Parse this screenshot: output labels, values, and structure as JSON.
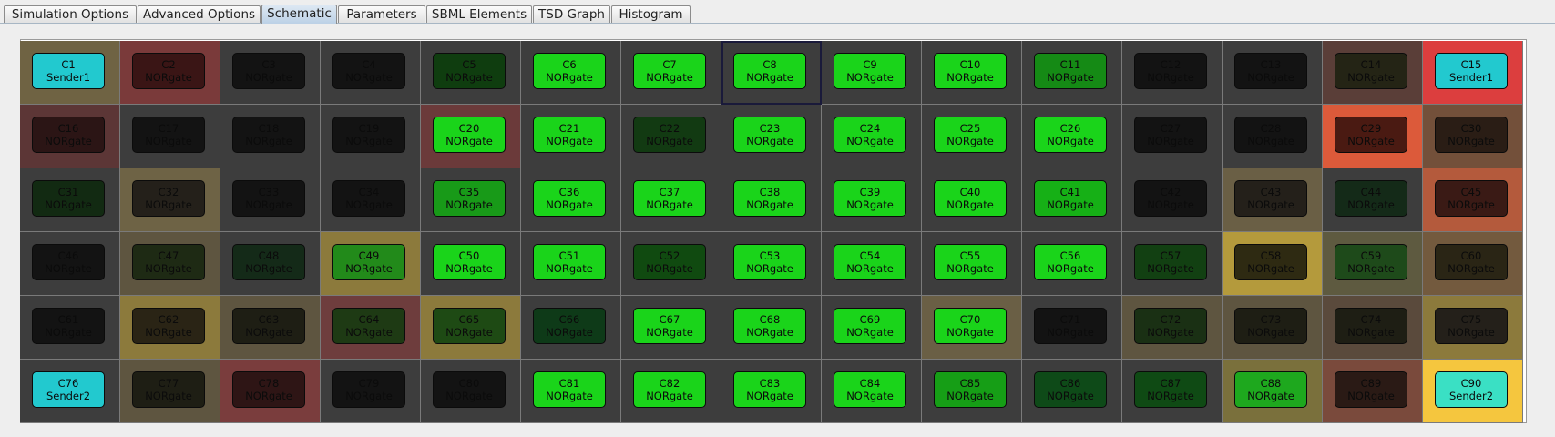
{
  "tabs": [
    {
      "label": "Simulation Options",
      "active": false
    },
    {
      "label": "Advanced Options",
      "active": false
    },
    {
      "label": "Schematic",
      "active": true
    },
    {
      "label": "Parameters",
      "active": false
    },
    {
      "label": "SBML Elements",
      "active": false
    },
    {
      "label": "TSD Graph",
      "active": false
    },
    {
      "label": "Histogram",
      "active": false
    }
  ],
  "selected_cell": "C8",
  "grid": {
    "rows": 6,
    "cols": 15,
    "cells": [
      {
        "id": "C1",
        "type": "Sender1",
        "cell_color": "#6f6343",
        "gate_color": "#22c9cf"
      },
      {
        "id": "C2",
        "type": "NORgate",
        "cell_color": "#7a3a3a",
        "gate_color": "#3a1515"
      },
      {
        "id": "C3",
        "type": "NORgate",
        "cell_color": "#3d3d3d",
        "gate_color": "#131313"
      },
      {
        "id": "C4",
        "type": "NORgate",
        "cell_color": "#3d3d3d",
        "gate_color": "#131313"
      },
      {
        "id": "C5",
        "type": "NORgate",
        "cell_color": "#3d3d3d",
        "gate_color": "#0f3d0f"
      },
      {
        "id": "C6",
        "type": "NORgate",
        "cell_color": "#3d3d3d",
        "gate_color": "#1ad41a"
      },
      {
        "id": "C7",
        "type": "NORgate",
        "cell_color": "#3d3d3d",
        "gate_color": "#1ad41a"
      },
      {
        "id": "C8",
        "type": "NORgate",
        "cell_color": "#3d3d3d",
        "gate_color": "#1ad41a"
      },
      {
        "id": "C9",
        "type": "NORgate",
        "cell_color": "#3d3d3d",
        "gate_color": "#1ad41a"
      },
      {
        "id": "C10",
        "type": "NORgate",
        "cell_color": "#3d3d3d",
        "gate_color": "#1ad41a"
      },
      {
        "id": "C11",
        "type": "NORgate",
        "cell_color": "#3d3d3d",
        "gate_color": "#158a15"
      },
      {
        "id": "C12",
        "type": "NORgate",
        "cell_color": "#3d3d3d",
        "gate_color": "#131313"
      },
      {
        "id": "C13",
        "type": "NORgate",
        "cell_color": "#3d3d3d",
        "gate_color": "#131313"
      },
      {
        "id": "C14",
        "type": "NORgate",
        "cell_color": "#5a3e38",
        "gate_color": "#242415"
      },
      {
        "id": "C15",
        "type": "Sender1",
        "cell_color": "#dc3e3e",
        "gate_color": "#22c9cf"
      },
      {
        "id": "C16",
        "type": "NORgate",
        "cell_color": "#5c3636",
        "gate_color": "#2b1515"
      },
      {
        "id": "C17",
        "type": "NORgate",
        "cell_color": "#3d3d3d",
        "gate_color": "#131313"
      },
      {
        "id": "C18",
        "type": "NORgate",
        "cell_color": "#3d3d3d",
        "gate_color": "#131313"
      },
      {
        "id": "C19",
        "type": "NORgate",
        "cell_color": "#3d3d3d",
        "gate_color": "#131313"
      },
      {
        "id": "C20",
        "type": "NORgate",
        "cell_color": "#6b3a3a",
        "gate_color": "#1ad41a"
      },
      {
        "id": "C21",
        "type": "NORgate",
        "cell_color": "#3d3d3d",
        "gate_color": "#1ad41a"
      },
      {
        "id": "C22",
        "type": "NORgate",
        "cell_color": "#3d3d3d",
        "gate_color": "#123a12"
      },
      {
        "id": "C23",
        "type": "NORgate",
        "cell_color": "#3d3d3d",
        "gate_color": "#1ad41a"
      },
      {
        "id": "C24",
        "type": "NORgate",
        "cell_color": "#3d3d3d",
        "gate_color": "#1ad41a"
      },
      {
        "id": "C25",
        "type": "NORgate",
        "cell_color": "#3d3d3d",
        "gate_color": "#1ad41a"
      },
      {
        "id": "C26",
        "type": "NORgate",
        "cell_color": "#3d3d3d",
        "gate_color": "#1ad41a"
      },
      {
        "id": "C27",
        "type": "NORgate",
        "cell_color": "#3d3d3d",
        "gate_color": "#131313"
      },
      {
        "id": "C28",
        "type": "NORgate",
        "cell_color": "#3d3d3d",
        "gate_color": "#131313"
      },
      {
        "id": "C29",
        "type": "NORgate",
        "cell_color": "#dc5a3a",
        "gate_color": "#4a1a12"
      },
      {
        "id": "C30",
        "type": "NORgate",
        "cell_color": "#73503a",
        "gate_color": "#2a1d15"
      },
      {
        "id": "C31",
        "type": "NORgate",
        "cell_color": "#3d3d3d",
        "gate_color": "#122a12"
      },
      {
        "id": "C32",
        "type": "NORgate",
        "cell_color": "#6e6345",
        "gate_color": "#24201a"
      },
      {
        "id": "C33",
        "type": "NORgate",
        "cell_color": "#3d3d3d",
        "gate_color": "#131313"
      },
      {
        "id": "C34",
        "type": "NORgate",
        "cell_color": "#3d3d3d",
        "gate_color": "#131313"
      },
      {
        "id": "C35",
        "type": "NORgate",
        "cell_color": "#3d3d3d",
        "gate_color": "#189a18"
      },
      {
        "id": "C36",
        "type": "NORgate",
        "cell_color": "#3d3d3d",
        "gate_color": "#1ad41a"
      },
      {
        "id": "C37",
        "type": "NORgate",
        "cell_color": "#3d3d3d",
        "gate_color": "#1ad41a"
      },
      {
        "id": "C38",
        "type": "NORgate",
        "cell_color": "#3d3d3d",
        "gate_color": "#1ad41a"
      },
      {
        "id": "C39",
        "type": "NORgate",
        "cell_color": "#3d3d3d",
        "gate_color": "#1ad41a"
      },
      {
        "id": "C40",
        "type": "NORgate",
        "cell_color": "#3d3d3d",
        "gate_color": "#1ad41a"
      },
      {
        "id": "C41",
        "type": "NORgate",
        "cell_color": "#3d3d3d",
        "gate_color": "#16b016"
      },
      {
        "id": "C42",
        "type": "NORgate",
        "cell_color": "#3d3d3d",
        "gate_color": "#131313"
      },
      {
        "id": "C43",
        "type": "NORgate",
        "cell_color": "#6a5f45",
        "gate_color": "#24201a"
      },
      {
        "id": "C44",
        "type": "NORgate",
        "cell_color": "#3d3d3d",
        "gate_color": "#142a18"
      },
      {
        "id": "C45",
        "type": "NORgate",
        "cell_color": "#b45a3c",
        "gate_color": "#3a1a15"
      },
      {
        "id": "C46",
        "type": "NORgate",
        "cell_color": "#3d3d3d",
        "gate_color": "#131313"
      },
      {
        "id": "C47",
        "type": "NORgate",
        "cell_color": "#5e5540",
        "gate_color": "#1e2a14"
      },
      {
        "id": "C48",
        "type": "NORgate",
        "cell_color": "#3d3d3d",
        "gate_color": "#142a18"
      },
      {
        "id": "C49",
        "type": "NORgate",
        "cell_color": "#8c7a3c",
        "gate_color": "#228a1a"
      },
      {
        "id": "C50",
        "type": "NORgate",
        "cell_color": "#3d3d3d",
        "gate_color": "#1ad41a"
      },
      {
        "id": "C51",
        "type": "NORgate",
        "cell_color": "#3d3d3d",
        "gate_color": "#1ad41a"
      },
      {
        "id": "C52",
        "type": "NORgate",
        "cell_color": "#3d3d3d",
        "gate_color": "#104a10"
      },
      {
        "id": "C53",
        "type": "NORgate",
        "cell_color": "#3d3d3d",
        "gate_color": "#1ad41a"
      },
      {
        "id": "C54",
        "type": "NORgate",
        "cell_color": "#3d3d3d",
        "gate_color": "#1ad41a"
      },
      {
        "id": "C55",
        "type": "NORgate",
        "cell_color": "#3d3d3d",
        "gate_color": "#1ad41a"
      },
      {
        "id": "C56",
        "type": "NORgate",
        "cell_color": "#3d3d3d",
        "gate_color": "#1ad41a"
      },
      {
        "id": "C57",
        "type": "NORgate",
        "cell_color": "#3d3d3d",
        "gate_color": "#124012"
      },
      {
        "id": "C58",
        "type": "NORgate",
        "cell_color": "#b49a3c",
        "gate_color": "#2e2a12"
      },
      {
        "id": "C59",
        "type": "NORgate",
        "cell_color": "#5e5a40",
        "gate_color": "#1e4a1a"
      },
      {
        "id": "C60",
        "type": "NORgate",
        "cell_color": "#735a3e",
        "gate_color": "#2a2515"
      },
      {
        "id": "C61",
        "type": "NORgate",
        "cell_color": "#3d3d3d",
        "gate_color": "#131313"
      },
      {
        "id": "C62",
        "type": "NORgate",
        "cell_color": "#8c7a3c",
        "gate_color": "#2a2415"
      },
      {
        "id": "C63",
        "type": "NORgate",
        "cell_color": "#5e5540",
        "gate_color": "#1e1e14"
      },
      {
        "id": "C64",
        "type": "NORgate",
        "cell_color": "#6e3d3d",
        "gate_color": "#1e3a14"
      },
      {
        "id": "C65",
        "type": "NORgate",
        "cell_color": "#8c7a3c",
        "gate_color": "#1e4a14"
      },
      {
        "id": "C66",
        "type": "NORgate",
        "cell_color": "#3d3d3d",
        "gate_color": "#0e3a18"
      },
      {
        "id": "C67",
        "type": "NORgate",
        "cell_color": "#3d3d3d",
        "gate_color": "#1ad41a"
      },
      {
        "id": "C68",
        "type": "NORgate",
        "cell_color": "#3d3d3d",
        "gate_color": "#1ad41a"
      },
      {
        "id": "C69",
        "type": "NORgate",
        "cell_color": "#3d3d3d",
        "gate_color": "#1ad41a"
      },
      {
        "id": "C70",
        "type": "NORgate",
        "cell_color": "#6a5f45",
        "gate_color": "#1ad41a"
      },
      {
        "id": "C71",
        "type": "NORgate",
        "cell_color": "#3d3d3d",
        "gate_color": "#131313"
      },
      {
        "id": "C72",
        "type": "NORgate",
        "cell_color": "#5e5540",
        "gate_color": "#1a3014"
      },
      {
        "id": "C73",
        "type": "NORgate",
        "cell_color": "#5e5540",
        "gate_color": "#1e1e14"
      },
      {
        "id": "C74",
        "type": "NORgate",
        "cell_color": "#5a4a3c",
        "gate_color": "#1e1e14"
      },
      {
        "id": "C75",
        "type": "NORgate",
        "cell_color": "#8c7a3c",
        "gate_color": "#24201a"
      },
      {
        "id": "C76",
        "type": "Sender2",
        "cell_color": "#3d3d3d",
        "gate_color": "#22c9cf"
      },
      {
        "id": "C77",
        "type": "NORgate",
        "cell_color": "#5e5540",
        "gate_color": "#1e1e14"
      },
      {
        "id": "C78",
        "type": "NORgate",
        "cell_color": "#7a3d3d",
        "gate_color": "#2e1515"
      },
      {
        "id": "C79",
        "type": "NORgate",
        "cell_color": "#3d3d3d",
        "gate_color": "#131313"
      },
      {
        "id": "C80",
        "type": "NORgate",
        "cell_color": "#3d3d3d",
        "gate_color": "#131313"
      },
      {
        "id": "C81",
        "type": "NORgate",
        "cell_color": "#3d3d3d",
        "gate_color": "#1ad41a"
      },
      {
        "id": "C82",
        "type": "NORgate",
        "cell_color": "#3d3d3d",
        "gate_color": "#1ad41a"
      },
      {
        "id": "C83",
        "type": "NORgate",
        "cell_color": "#3d3d3d",
        "gate_color": "#1ad41a"
      },
      {
        "id": "C84",
        "type": "NORgate",
        "cell_color": "#3d3d3d",
        "gate_color": "#1ad41a"
      },
      {
        "id": "C85",
        "type": "NORgate",
        "cell_color": "#3d3d3d",
        "gate_color": "#169e16"
      },
      {
        "id": "C86",
        "type": "NORgate",
        "cell_color": "#3d3d3d",
        "gate_color": "#0e4a18"
      },
      {
        "id": "C87",
        "type": "NORgate",
        "cell_color": "#3d3d3d",
        "gate_color": "#0f4a14"
      },
      {
        "id": "C88",
        "type": "NORgate",
        "cell_color": "#7a703c",
        "gate_color": "#1ea81e"
      },
      {
        "id": "C89",
        "type": "NORgate",
        "cell_color": "#7a4a3c",
        "gate_color": "#2a1a15"
      },
      {
        "id": "C90",
        "type": "Sender2",
        "cell_color": "#f5c63e",
        "gate_color": "#3ae0c4"
      }
    ]
  }
}
